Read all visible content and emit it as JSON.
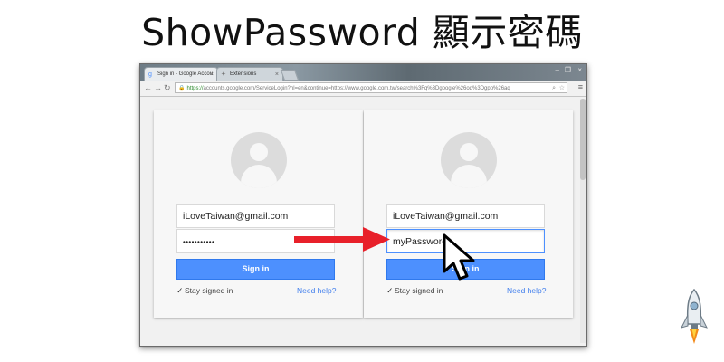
{
  "headline": "ShowPassword 顯示密碼",
  "browser": {
    "tabs": [
      {
        "label": "Sign in - Google Accou",
        "icon": "google-favicon",
        "active": true
      },
      {
        "label": "Extensions",
        "icon": "puzzle-icon",
        "active": false
      }
    ],
    "close_glyph": "×",
    "window_controls": [
      "–",
      "❐",
      "×"
    ],
    "url_scheme": "https://",
    "url_rest": "accounts.google.com/ServiceLogin?hl=en&continue=https://www.google.com.tw/search%3Fq%3Dgoogle%26oq%3Dgpp%26aq"
  },
  "left_card": {
    "email": "iLoveTaiwan@gmail.com",
    "password_mask": "•••••••••••",
    "signin_label": "Sign in",
    "stay_label": "Stay signed in",
    "help_label": "Need help?"
  },
  "right_card": {
    "email": "iLoveTaiwan@gmail.com",
    "password_visible": "myPassword",
    "signin_label": "Sign in",
    "stay_label": "Stay signed in",
    "help_label": "Need help?"
  },
  "colors": {
    "signin_blue": "#4d90fe",
    "link_blue": "#427fed",
    "arrow_red": "#e8202a"
  },
  "icons": [
    "back-icon",
    "forward-icon",
    "reload-icon",
    "lock-icon",
    "search-icon",
    "star-icon",
    "menu-icon",
    "cursor-icon",
    "rocket-icon"
  ]
}
